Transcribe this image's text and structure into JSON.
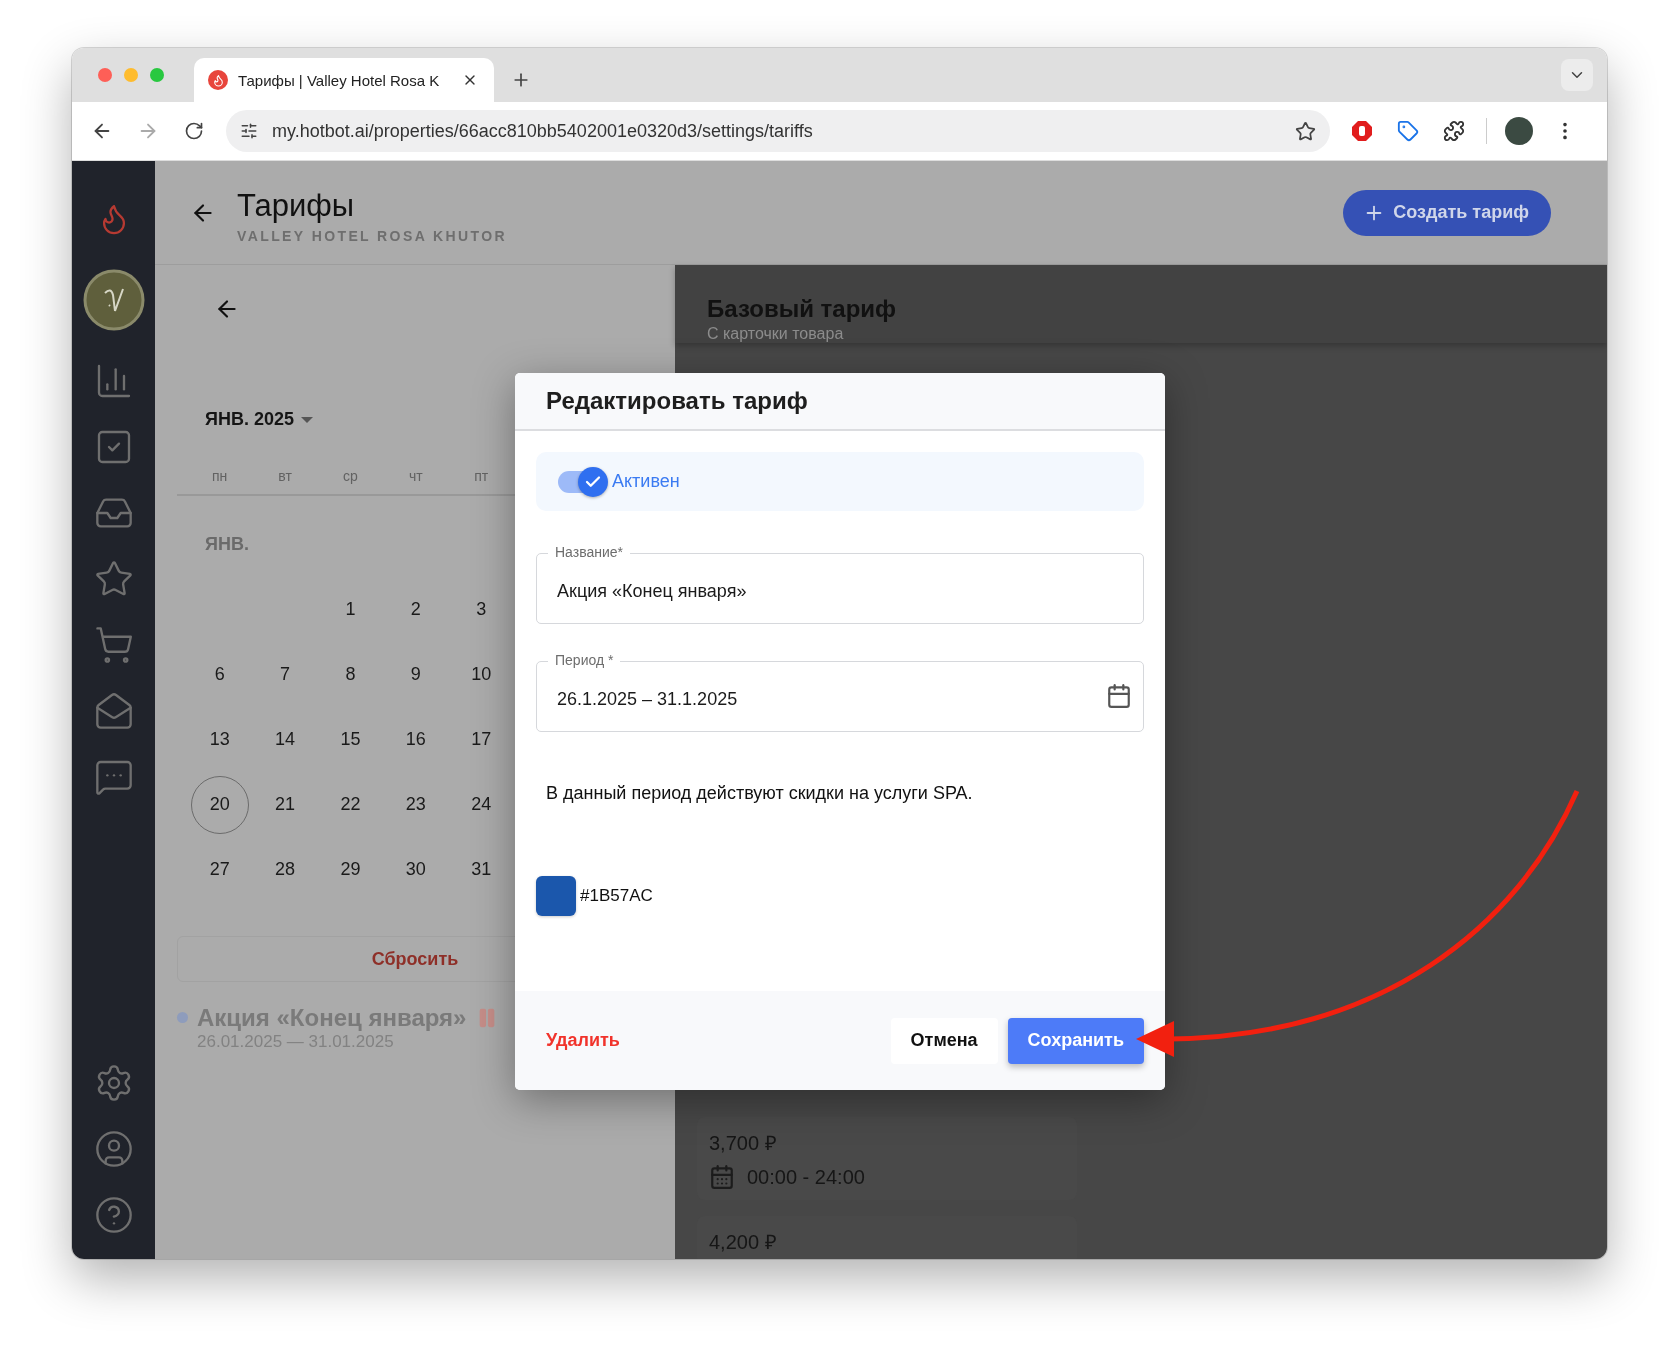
{
  "browser": {
    "tab_title": "Тарифы | Valley Hotel Rosa K",
    "url": "my.hotbot.ai/properties/66acc810bb5402001e0320d3/settings/tariffs"
  },
  "header": {
    "title": "Тарифы",
    "subtitle": "VALLEY HOTEL ROSA KHUTOR",
    "create_button": "Создать тариф"
  },
  "calendar": {
    "month_picker": "ЯНВ. 2025",
    "weekdays": [
      "пн",
      "вт",
      "ср",
      "чт",
      "пт"
    ],
    "month_label": "ЯНВ.",
    "weeks": [
      [
        {
          "day": "1",
          "today": false
        },
        {
          "day": "2",
          "today": false
        },
        {
          "day": "3",
          "today": false
        }
      ],
      [
        {
          "day": "6",
          "today": false
        },
        {
          "day": "7",
          "today": false
        },
        {
          "day": "8",
          "today": false
        },
        {
          "day": "9",
          "today": false
        },
        {
          "day": "10",
          "today": false
        }
      ],
      [
        {
          "day": "13",
          "today": false
        },
        {
          "day": "14",
          "today": false
        },
        {
          "day": "15",
          "today": false
        },
        {
          "day": "16",
          "today": false
        },
        {
          "day": "17",
          "today": false
        }
      ],
      [
        {
          "day": "20",
          "today": true
        },
        {
          "day": "21",
          "today": false
        },
        {
          "day": "22",
          "today": false
        },
        {
          "day": "23",
          "today": false
        },
        {
          "day": "24",
          "today": false
        }
      ],
      [
        {
          "day": "27",
          "today": false
        },
        {
          "day": "28",
          "today": false
        },
        {
          "day": "29",
          "today": false
        },
        {
          "day": "30",
          "today": false
        },
        {
          "day": "31",
          "today": false
        }
      ]
    ],
    "reset_button": "Сбросить"
  },
  "tariffs": [
    {
      "name": "Акция «Конец января»",
      "dates": "26.01.2025 — 31.01.2025",
      "color": "#8e9cbc",
      "paused": true
    }
  ],
  "base_tariff": {
    "title": "Базовый тариф",
    "subtitle": "С карточки товара",
    "prices": [
      {
        "price": "3,700 ₽",
        "hours": "00:00 - 24:00"
      },
      {
        "price": "4,200 ₽"
      }
    ]
  },
  "dialog": {
    "title": "Редактировать тариф",
    "active": {
      "label": "Активен",
      "on": true
    },
    "fields": [
      {
        "kind": "text",
        "label": "Название*",
        "value": "Акция «Конец января»"
      },
      {
        "kind": "date",
        "label": "Период *",
        "value": "26.1.2025 – 31.1.2025"
      }
    ],
    "description": "В данный период действуют скидки на услуги SPA.",
    "color_value": "#1B57AC",
    "delete_button": "Удалить",
    "cancel_button": "Отмена",
    "save_button": "Сохранить"
  }
}
